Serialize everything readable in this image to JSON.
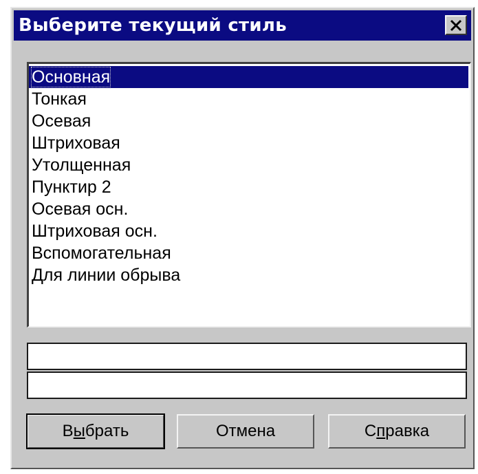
{
  "window": {
    "title": "Выберите текущий стиль",
    "close_icon": "close-x-icon"
  },
  "styles_list": {
    "selected_index": 0,
    "items": [
      "Основная",
      "Тонкая",
      "Осевая",
      "Штриховая",
      "Утолщенная",
      "Пунктир 2",
      "Осевая осн.",
      "Штриховая осн.",
      "Вспомогательная",
      "Для линии обрыва"
    ]
  },
  "preview": {
    "top_value": "",
    "bottom_value": ""
  },
  "buttons": {
    "select": {
      "pre": "В",
      "accel": "ы",
      "post": "брать"
    },
    "cancel": {
      "label": "Отмена"
    },
    "help": {
      "pre": "С",
      "accel": "п",
      "post": "равка"
    }
  },
  "colors": {
    "title_bar": "#0b0b82",
    "dialog_face": "#c7c7c7",
    "selection": "#0b0b82"
  }
}
